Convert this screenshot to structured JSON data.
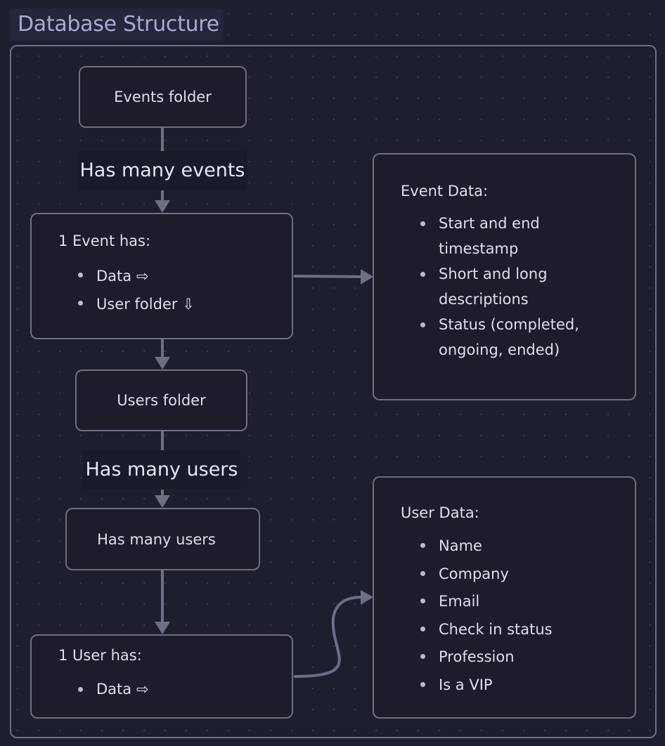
{
  "group": {
    "title": "Database Structure"
  },
  "nodes": {
    "events_folder": {
      "label": "Events folder"
    },
    "event": {
      "heading": "1 Event has:",
      "items": [
        "Data ⇨",
        "User folder ⇩"
      ]
    },
    "event_data": {
      "heading": "Event Data:",
      "items": [
        [
          "Start and end",
          "timestamp"
        ],
        [
          "Short and long",
          "descriptions"
        ],
        [
          "Status (completed,",
          "ongoing, ended)"
        ]
      ]
    },
    "users_folder": {
      "label": "Users folder"
    },
    "has_many_users_node": {
      "label": "Has many users"
    },
    "user": {
      "heading": "1 User has:",
      "items": [
        "Data ⇨"
      ]
    },
    "user_data": {
      "heading": "User Data:",
      "items": [
        "Name",
        "Company",
        "Email",
        "Check in status",
        "Profession",
        "Is a VIP"
      ]
    }
  },
  "edges": {
    "events_to_event": {
      "label": "Has many events"
    },
    "users_folder_to_users": {
      "label": "Has many users"
    }
  },
  "colors": {
    "background": "#1e1f2e",
    "node_fill": "#1c1c2b",
    "stroke": "#6d6e88",
    "text": "#dcdff5",
    "title_text": "#a6abd2"
  }
}
